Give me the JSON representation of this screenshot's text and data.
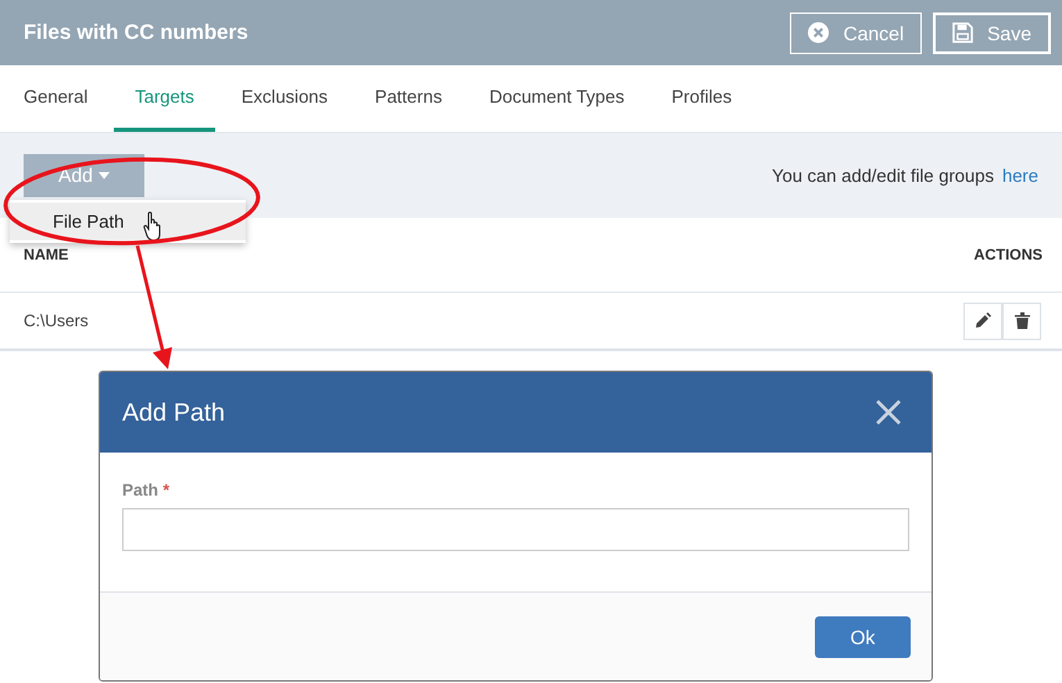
{
  "window": {
    "title": "Files with CC numbers"
  },
  "header_buttons": [
    {
      "label": "Cancel",
      "kind": "cancel"
    },
    {
      "label": "Save",
      "kind": "save"
    }
  ],
  "tabs": [
    {
      "label": "General",
      "selected": false
    },
    {
      "label": "Targets",
      "selected": true
    },
    {
      "label": "Exclusions",
      "selected": false
    },
    {
      "label": "Patterns",
      "selected": false
    },
    {
      "label": "Document Types",
      "selected": false
    },
    {
      "label": "Profiles",
      "selected": false
    }
  ],
  "toolbar": {
    "add_button": "Add",
    "hint": "You can add/edit file groups",
    "link": "here"
  },
  "add_menu": {
    "items": [
      {
        "label": "File Path",
        "selected": true
      }
    ]
  },
  "table": {
    "columns": [
      "NAME",
      "ACTIONS"
    ],
    "rows": [
      {
        "name": "C:\\Users"
      }
    ]
  },
  "dialog": {
    "title": "Add Path",
    "field": {
      "label": "Path",
      "required_mark": "*"
    },
    "buttons": [
      "Ok"
    ]
  }
}
